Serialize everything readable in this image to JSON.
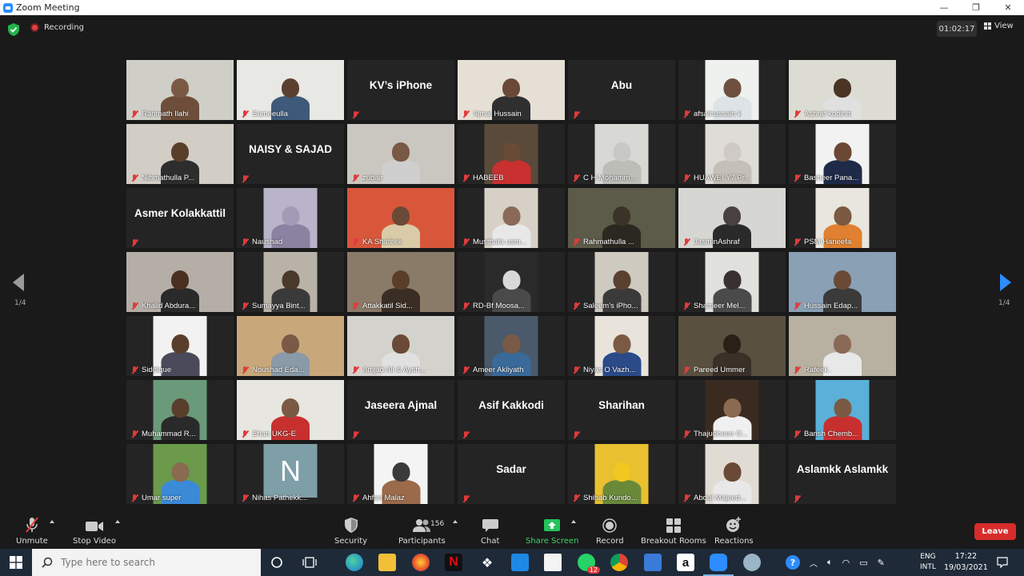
{
  "window": {
    "title": "Zoom Meeting",
    "controls": [
      "—",
      "❐",
      "✕"
    ]
  },
  "topbar": {
    "recording_label": "Recording",
    "timer": "01:02:17",
    "view_label": "View"
  },
  "pagination": {
    "left_page": "1/4",
    "right_page": "1/4"
  },
  "tiles": [
    {
      "name": "Rahmath Ilahi",
      "kind": "video",
      "bg": "#cfcfc8",
      "skin": "#7b5a44",
      "shirt": "#6e4e3a"
    },
    {
      "name": "Sameeulla",
      "kind": "video",
      "bg": "#e8e8e4",
      "skin": "#5b4030",
      "shirt": "#3d5a7a"
    },
    {
      "name": "KV’s iPhone",
      "kind": "name"
    },
    {
      "name": "Ajmal Hussain",
      "kind": "video",
      "bg": "#e6dfd6",
      "skin": "#6a4a36",
      "shirt": "#2f2f2f"
    },
    {
      "name": "Abu",
      "kind": "name"
    },
    {
      "name": "afsalhussain k",
      "kind": "pillar",
      "bg": "#eef1ee",
      "skin": "#6e5040",
      "shirt": "#dde3e6"
    },
    {
      "name": "Ashraf kodinhi",
      "kind": "video",
      "bg": "#dcdcd2",
      "skin": "#4a3426",
      "shirt": "#e0e0e0"
    },
    {
      "name": "Nihmathulla P...",
      "kind": "video",
      "bg": "#d2cec6",
      "skin": "#5a3e2c",
      "shirt": "#2d2d2d"
    },
    {
      "name": "NAISY & SAJAD",
      "kind": "name"
    },
    {
      "name": "zubair",
      "kind": "video",
      "bg": "#c9c7c0",
      "skin": "#7a5846",
      "shirt": "#cfcfcf"
    },
    {
      "name": "HABEEB",
      "kind": "pillar",
      "bg": "#5a4a3a",
      "skin": "#6a4a36",
      "shirt": "#c93030"
    },
    {
      "name": "C H Mohamm...",
      "kind": "pillar",
      "bg": "#d8d8d4",
      "skin": "#c8c8c4",
      "shirt": "#bdbdb8"
    },
    {
      "name": "HUAWEI Y7 Pr...",
      "kind": "pillar",
      "bg": "#dedcd6",
      "skin": "#cfcbc4",
      "shirt": "#c4c0b8"
    },
    {
      "name": "Basheer Pana...",
      "kind": "pillar",
      "bg": "#f2f2f2",
      "skin": "#6a4834",
      "shirt": "#1e2a48"
    },
    {
      "name": "Asmer Kolakkattil",
      "kind": "name"
    },
    {
      "name": "Naushad",
      "kind": "pillar",
      "bg": "#b9b4c9",
      "skin": "#a39bb5",
      "shirt": "#8a82a0"
    },
    {
      "name": "KA Shafeek",
      "kind": "video",
      "active": true,
      "bg": "#d8573a",
      "skin": "#6a4a36",
      "shirt": "#d9cba8"
    },
    {
      "name": "Musthafa usm...",
      "kind": "pillar",
      "bg": "#d6d0c6",
      "skin": "#8a6a56",
      "shirt": "#e8e8e8"
    },
    {
      "name": "Rahmathulla ...",
      "kind": "video",
      "bg": "#5c5a48",
      "skin": "#3a3428",
      "shirt": "#2a2820"
    },
    {
      "name": "JasminAshraf",
      "kind": "video",
      "bg": "#d6d6d2",
      "skin": "#4a4040",
      "shirt": "#2a2a2a"
    },
    {
      "name": "PSM Haneefa",
      "kind": "pillar",
      "bg": "#e8e6de",
      "skin": "#7a5a40",
      "shirt": "#e08030"
    },
    {
      "name": "Khalid Abdura...",
      "kind": "video",
      "bg": "#b4aea6",
      "skin": "#4a3020",
      "shirt": "#2a2a2a"
    },
    {
      "name": "Sumayya Bint...",
      "kind": "pillar",
      "bg": "#b8b2a8",
      "skin": "#4a3828",
      "shirt": "#3a3a3a"
    },
    {
      "name": "Attakkatil Sid...",
      "kind": "video",
      "bg": "#8a7a68",
      "skin": "#5a3e2c",
      "shirt": "#3a2e24"
    },
    {
      "name": "RD-Bf Moosa...",
      "kind": "pillar",
      "bg": "#2a2a2a",
      "skin": "#d8d8d8",
      "shirt": "#4a4a4a"
    },
    {
      "name": "Saleem's iPho...",
      "kind": "pillar",
      "bg": "#cfcac0",
      "skin": "#5a4030",
      "shirt": "#3a3a3a"
    },
    {
      "name": "Shameer Mel...",
      "kind": "pillar",
      "bg": "#e0e0dc",
      "skin": "#3a3030",
      "shirt": "#4a4a4a"
    },
    {
      "name": "Hussain Edap...",
      "kind": "video",
      "bg": "#8aa0b4",
      "skin": "#6a4a36",
      "shirt": "#3a3a3a"
    },
    {
      "name": "Siddique",
      "kind": "pillar",
      "bg": "#f2f2f2",
      "skin": "#5a3e2c",
      "shirt": "#4a4a5a"
    },
    {
      "name": "Noushad Eda...",
      "kind": "video",
      "bg": "#c8a87a",
      "skin": "#7a5a44",
      "shirt": "#8a9aa8"
    },
    {
      "name": "Amjad Ali & Aysh...",
      "kind": "video",
      "bg": "#d4d2cc",
      "skin": "#6a4a36",
      "shirt": "#e0e0e0"
    },
    {
      "name": "Ameer Akliyath",
      "kind": "pillar",
      "bg": "#4a5a6a",
      "skin": "#7a5a44",
      "shirt": "#3a6a9a"
    },
    {
      "name": "Niyas O Vazh...",
      "kind": "pillar",
      "bg": "#e8e4dc",
      "skin": "#7a5a44",
      "shirt": "#2a4a8a"
    },
    {
      "name": "Pareed Ummer",
      "kind": "video",
      "bg": "#5a5040",
      "skin": "#2a2018",
      "shirt": "#3a3028"
    },
    {
      "name": "Rafeek .",
      "kind": "video",
      "bg": "#b8b0a0",
      "skin": "#8a6a56",
      "shirt": "#e8e8e8"
    },
    {
      "name": "Muhammad R...",
      "kind": "pillar",
      "bg": "#6a9a7a",
      "skin": "#5a3e2c",
      "shirt": "#2a2a2a"
    },
    {
      "name": "Ehan UKG-E",
      "kind": "video",
      "bg": "#e8e6e0",
      "skin": "#7a5a44",
      "shirt": "#c83030"
    },
    {
      "name": "Jaseera Ajmal",
      "kind": "name"
    },
    {
      "name": "Asif Kakkodi",
      "kind": "name"
    },
    {
      "name": "Sharihan",
      "kind": "name"
    },
    {
      "name": "Thajudheen O...",
      "kind": "pillar",
      "bg": "#3a2a20",
      "skin": "#8a6a50",
      "shirt": "#f0f0f0"
    },
    {
      "name": "Barish Chemb...",
      "kind": "pillar",
      "bg": "#5ab0d8",
      "skin": "#7a5a44",
      "shirt": "#c83030"
    },
    {
      "name": "Umar super",
      "kind": "pillar",
      "bg": "#6a9a4a",
      "skin": "#8a6a50",
      "shirt": "#3a8ad8"
    },
    {
      "name": "Nihas Pathekk...",
      "kind": "letter",
      "letter": "N"
    },
    {
      "name": "Ahfan Malaz",
      "kind": "pillar",
      "bg": "#f4f4f4",
      "skin": "#3a3a3a",
      "shirt": "#9a6a4a"
    },
    {
      "name": "Sadar",
      "kind": "name"
    },
    {
      "name": "Shihab Kundo...",
      "kind": "pillar",
      "bg": "#e8c030",
      "skin": "#f0c820",
      "shirt": "#6a8a3a"
    },
    {
      "name": "Abdul Majeed...",
      "kind": "pillar",
      "bg": "#e0dcd4",
      "skin": "#6a4a36",
      "shirt": "#e8e8e8"
    },
    {
      "name": "Aslamkk Aslamkk",
      "kind": "name"
    }
  ],
  "toolbar": {
    "unmute": "Unmute",
    "stop_video": "Stop Video",
    "security": "Security",
    "participants": "Participants",
    "participant_count": "156",
    "chat": "Chat",
    "share_screen": "Share Screen",
    "record": "Record",
    "breakout_rooms": "Breakout Rooms",
    "reactions": "Reactions",
    "leave": "Leave"
  },
  "taskbar": {
    "search_placeholder": "Type here to search",
    "whatsapp_badge": "12",
    "lang_top": "ENG",
    "lang_bottom": "INTL",
    "time": "17:22",
    "date": "19/03/2021"
  },
  "colors": {
    "accent": "#2d8cff",
    "leave": "#d62c2c",
    "share": "#3fd16c",
    "active_speaker": "#d6e84a"
  }
}
